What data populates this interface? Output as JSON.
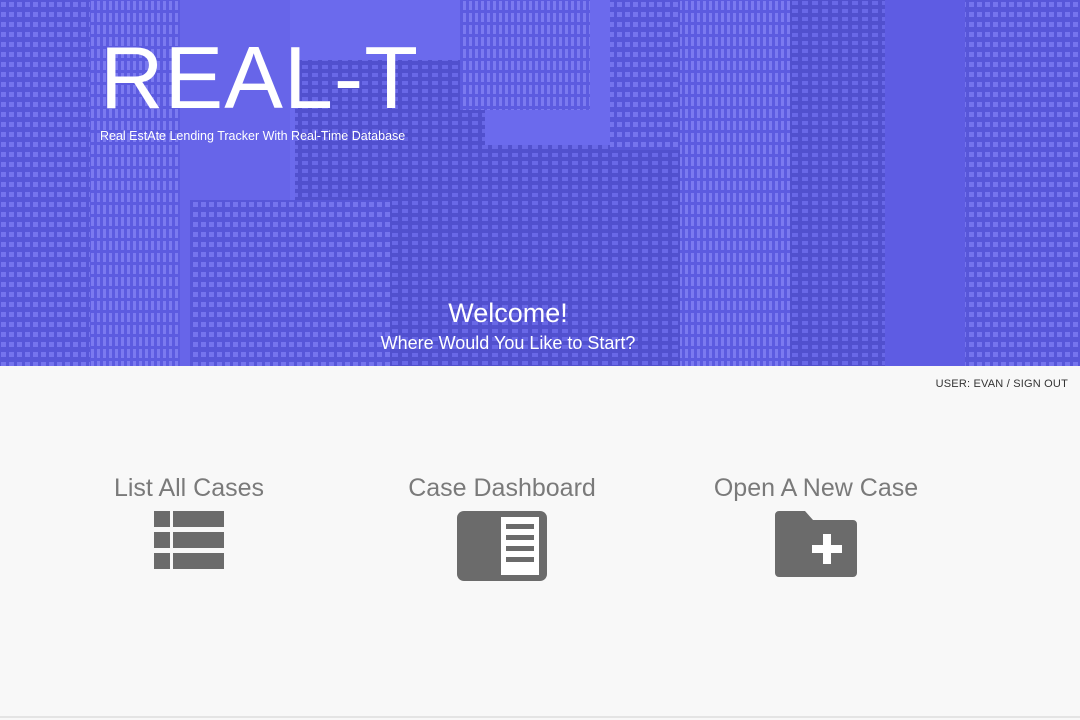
{
  "brand": {
    "title": "REAL-T",
    "subtitle": "Real EstAte Lending Tracker With Real-Time Database"
  },
  "hero": {
    "welcome": "Welcome!",
    "prompt": "Where Would You Like to Start?"
  },
  "user_bar": {
    "user_text": "USER: EVAN",
    "separator": " / ",
    "sign_out_label": "SIGN OUT"
  },
  "options": [
    {
      "label": "List All Cases",
      "icon": "list-icon"
    },
    {
      "label": "Case Dashboard",
      "icon": "dashboard-icon"
    },
    {
      "label": "Open A New Case",
      "icon": "new-folder-icon"
    }
  ],
  "colors": {
    "hero_tint": "#6260ec",
    "option_text": "#7a7a7a",
    "icon_fill": "#6b6b6b",
    "page_bg": "#f8f8f8"
  }
}
